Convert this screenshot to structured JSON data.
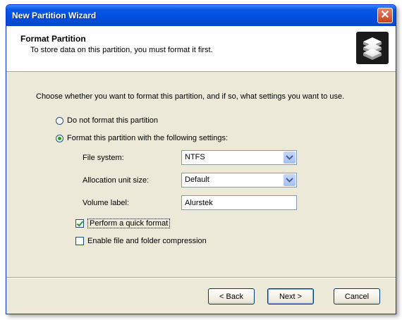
{
  "window": {
    "title": "New Partition Wizard",
    "close_glyph": "✕"
  },
  "header": {
    "title": "Format Partition",
    "subtitle": "To store data on this partition, you must format it first.",
    "icon": "disks-icon"
  },
  "instructions": "Choose whether you want to format this partition, and if so, what settings you want to use.",
  "options": {
    "no_format": {
      "label": "Do not format this partition",
      "checked": false
    },
    "format": {
      "label": "Format this partition with the following settings:",
      "checked": true
    }
  },
  "fields": {
    "file_system": {
      "label": "File system:",
      "value": "NTFS"
    },
    "allocation_unit_size": {
      "label": "Allocation unit size:",
      "value": "Default"
    },
    "volume_label": {
      "label": "Volume label:",
      "value": "Alurstek"
    }
  },
  "checkboxes": {
    "quick_format": {
      "label": "Perform a quick format",
      "checked": true
    },
    "compression": {
      "label": "Enable file and folder compression",
      "checked": false
    }
  },
  "buttons": {
    "back": "< Back",
    "next": "Next >",
    "cancel": "Cancel"
  },
  "colors": {
    "titlebar": "#0050e0",
    "dialog": "#ece9d8",
    "close": "#c8401c",
    "check": "#21a121"
  }
}
